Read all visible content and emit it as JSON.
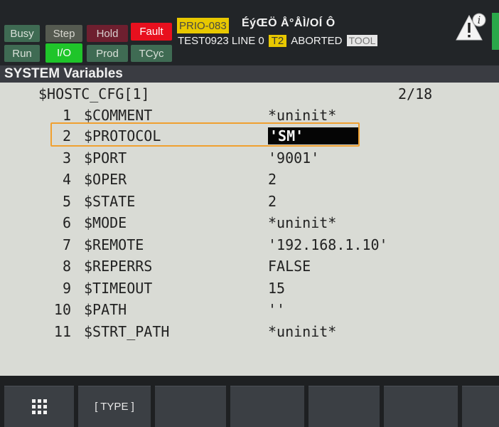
{
  "status": {
    "buttons": [
      {
        "label": "Busy",
        "bg": "#3f6b53",
        "fg": "#d8e0d8"
      },
      {
        "label": "Step",
        "bg": "#555a50",
        "fg": "#d8d8d0"
      },
      {
        "label": "Hold",
        "bg": "#6e1f2f",
        "fg": "#d8d0d0"
      },
      {
        "label": "Fault",
        "bg": "#e8101e",
        "fg": "#ffffff"
      },
      {
        "label": "Run",
        "bg": "#3f6b53",
        "fg": "#d8e0d8"
      },
      {
        "label": "I/O",
        "bg": "#1fc52a",
        "fg": "#ffffff"
      },
      {
        "label": "Prod",
        "bg": "#3f6b53",
        "fg": "#d8e0d8"
      },
      {
        "label": "TCyc",
        "bg": "#3f6b53",
        "fg": "#d8e0d8"
      }
    ],
    "prio": "PRIO-083",
    "garbled": "ÉýŒÖ Å°ÅÌ/OÍ  Ô",
    "program": "TEST0923 LINE 0",
    "mode": "T2",
    "state": "ABORTED",
    "tool": "TOOL"
  },
  "screen": {
    "title": "SYSTEM Variables",
    "subtitle": "$HOSTC_CFG[1]",
    "page": "2/18",
    "rows": [
      {
        "num": "1",
        "name": "$COMMENT",
        "value": "*uninit*"
      },
      {
        "num": "2",
        "name": "$PROTOCOL",
        "value": "'SM'"
      },
      {
        "num": "3",
        "name": "$PORT",
        "value": "'9001'"
      },
      {
        "num": "4",
        "name": "$OPER",
        "value": "2"
      },
      {
        "num": "5",
        "name": "$STATE",
        "value": "2"
      },
      {
        "num": "6",
        "name": "$MODE",
        "value": "*uninit*"
      },
      {
        "num": "7",
        "name": "$REMOTE",
        "value": "'192.168.1.10'"
      },
      {
        "num": "8",
        "name": "$REPERRS",
        "value": "FALSE"
      },
      {
        "num": "9",
        "name": "$TIMEOUT",
        "value": "15"
      },
      {
        "num": "10",
        "name": "$PATH",
        "value": "''"
      },
      {
        "num": "11",
        "name": "$STRT_PATH",
        "value": "*uninit*"
      }
    ]
  },
  "fkeys": {
    "menu_icon": "grid-icon",
    "type_label": "[ TYPE ]"
  },
  "colors": {
    "selection_outline": "#f0a030",
    "yellow_badge": "#e8c800"
  }
}
